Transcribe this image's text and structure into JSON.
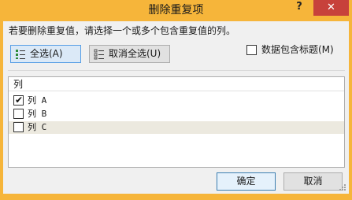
{
  "window": {
    "title": "删除重复项",
    "help_glyph": "?",
    "close_glyph": "✕",
    "accent_color": "#f6b53a",
    "close_color": "#c7413b"
  },
  "instruction": "若要删除重复值，请选择一个或多个包含重复值的列。",
  "toolbar": {
    "select_all_label": "全选(A)",
    "select_all_icon": "select-all-icon",
    "unselect_all_label": "取消全选(U)",
    "unselect_all_icon": "unselect-all-icon"
  },
  "header_option": {
    "label": "数据包含标题(M)",
    "checked": false
  },
  "columns_list": {
    "header": "列",
    "items": [
      {
        "label": "列 A",
        "checked": true
      },
      {
        "label": "列 B",
        "checked": false
      },
      {
        "label": "列 C",
        "checked": false
      }
    ],
    "highlight_color": "#ece9df"
  },
  "footer": {
    "ok_label": "确定",
    "cancel_label": "取消"
  }
}
